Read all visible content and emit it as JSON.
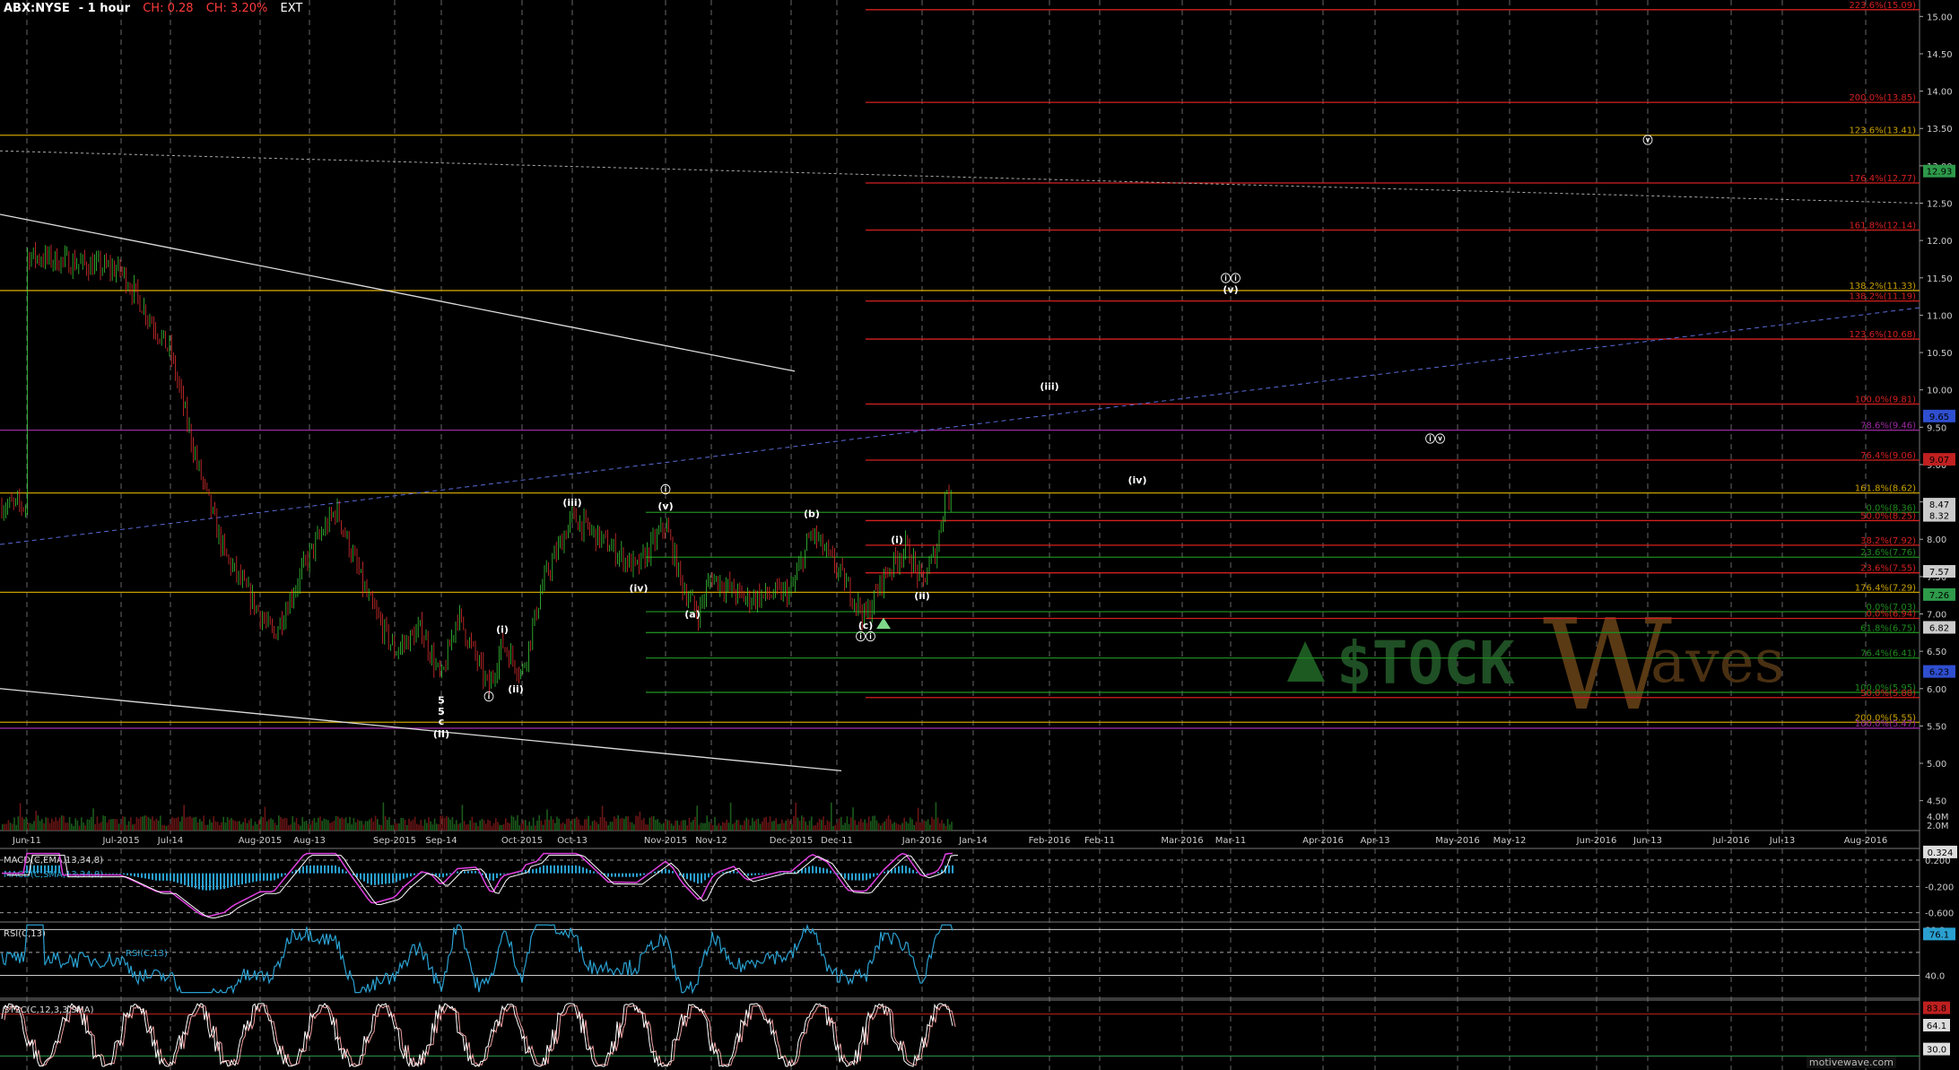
{
  "header": {
    "symbol": "ABX:NYSE",
    "interval": "- 1 hour",
    "change": "CH: 0.28",
    "change_pct": "CH: 3.20%",
    "session": "EXT"
  },
  "colors": {
    "background": "#000000",
    "candle_up": "#39c839",
    "candle_down": "#e03030",
    "fib_red": "#d42020",
    "fib_yellow": "#c8a000",
    "fib_green": "#1f8a1f",
    "purple": "#9a2aa0",
    "blue_dash": "#5a6ad8"
  },
  "watermark": "motivewave.com",
  "logo": {
    "left": "$TOCK",
    "right": "aves",
    "big": "W"
  },
  "chart_data": {
    "type": "candlestick",
    "title": "ABX:NYSE - 1 hour",
    "ylim": [
      4.1,
      15.1
    ],
    "price_axis": [
      "15.00",
      "14.50",
      "14.00",
      "13.50",
      "13.00",
      "12.50",
      "12.00",
      "11.50",
      "11.00",
      "10.50",
      "10.00",
      "9.50",
      "9.00",
      "8.50",
      "8.00",
      "7.50",
      "7.00",
      "6.50",
      "6.00",
      "5.50",
      "5.00",
      "4.50"
    ],
    "price_values": [
      15.0,
      14.5,
      14.0,
      13.5,
      13.0,
      12.5,
      12.0,
      11.5,
      11.0,
      10.5,
      10.0,
      9.5,
      9.0,
      8.5,
      8.0,
      7.5,
      7.0,
      6.5,
      6.0,
      5.5,
      5.0,
      4.5
    ],
    "time_axis": [
      "Jun-11",
      "Jul-2015",
      "Jul-14",
      "Aug-2015",
      "Aug-13",
      "Sep-2015",
      "Sep-14",
      "Oct-2015",
      "Oct-13",
      "Nov-2015",
      "Nov-12",
      "Dec-2015",
      "Dec-11",
      "Jan-2016",
      "Jan-14",
      "Feb-2016",
      "Feb-11",
      "Mar-2016",
      "Mar-11",
      "Apr-2016",
      "Apr-13",
      "May-2016",
      "May-12",
      "Jun-2016",
      "Jun-13",
      "Jul-2016",
      "Jul-13",
      "Aug-2016"
    ],
    "price_path": [
      [
        "Jun-11",
        11.8
      ],
      [
        "Jul-2015",
        11.6
      ],
      [
        "Jul-14",
        10.5
      ],
      [
        "Jul-20",
        9.0
      ],
      [
        "Jul-26",
        7.8
      ],
      [
        "Aug-2015",
        7.0
      ],
      [
        "Aug-04",
        6.7
      ],
      [
        "Aug-13",
        7.8
      ],
      [
        "Aug-19",
        8.4
      ],
      [
        "Aug-26",
        7.2
      ],
      [
        "Sep-2015",
        6.5
      ],
      [
        "Sep-06",
        6.8
      ],
      [
        "Sep-14",
        6.1
      ],
      [
        "Sep-18",
        7.0
      ],
      [
        "Sep-22",
        6.0
      ],
      [
        "Sep-26",
        6.6
      ],
      [
        "Oct-2015",
        6.2
      ],
      [
        "Oct-05",
        7.4
      ],
      [
        "Oct-13",
        8.3
      ],
      [
        "Oct-20",
        8.0
      ],
      [
        "Oct-26",
        7.6
      ],
      [
        "Nov-2015",
        8.2
      ],
      [
        "Nov-04",
        7.4
      ],
      [
        "Nov-08",
        7.0
      ],
      [
        "Nov-12",
        7.5
      ],
      [
        "Nov-20",
        7.2
      ],
      [
        "Dec-2015",
        7.3
      ],
      [
        "Dec-05",
        8.1
      ],
      [
        "Dec-11",
        7.6
      ],
      [
        "Dec-16",
        6.95
      ],
      [
        "Dec-20",
        7.5
      ],
      [
        "Dec-26",
        7.9
      ],
      [
        "Jan-2016",
        7.4
      ],
      [
        "Jan-05",
        7.9
      ],
      [
        "Jan-08",
        8.7
      ],
      [
        "Jan-09",
        8.45
      ]
    ],
    "last_price": "8.47",
    "volume_axis": [
      "4.0M",
      "2.0M"
    ],
    "fib_levels": [
      {
        "label": "223.6%(15.09)",
        "value": 15.09,
        "color": "red"
      },
      {
        "label": "200.0%(13.85)",
        "value": 13.85,
        "color": "red"
      },
      {
        "label": "123.6%(13.41)",
        "value": 13.41,
        "color": "yellow"
      },
      {
        "label": "176.4%(12.77)",
        "value": 12.77,
        "color": "red"
      },
      {
        "label": "161.8%(12.14)",
        "value": 12.14,
        "color": "red"
      },
      {
        "label": "138.2%(11.33)",
        "value": 11.33,
        "color": "yellow"
      },
      {
        "label": "138.2%(11.19)",
        "value": 11.19,
        "color": "red"
      },
      {
        "label": "123.6%(10.68)",
        "value": 10.68,
        "color": "red"
      },
      {
        "label": "100.0%(9.81)",
        "value": 9.81,
        "color": "red"
      },
      {
        "label": "78.6%(9.46)",
        "value": 9.46,
        "color": "purple"
      },
      {
        "label": "76.4%(9.06)",
        "value": 9.06,
        "color": "red"
      },
      {
        "label": "161.8%(8.62)",
        "value": 8.62,
        "color": "yellow"
      },
      {
        "label": "0.0%(8.36)",
        "value": 8.36,
        "color": "green"
      },
      {
        "label": "50.0%(8.25)",
        "value": 8.25,
        "color": "red"
      },
      {
        "label": "38.2%(7.92)",
        "value": 7.92,
        "color": "red"
      },
      {
        "label": "23.6%(7.76)",
        "value": 7.76,
        "color": "green"
      },
      {
        "label": "23.6%(7.55)",
        "value": 7.55,
        "color": "red"
      },
      {
        "label": "176.4%(7.29)",
        "value": 7.29,
        "color": "yellow"
      },
      {
        "label": "0.0%(7.03)",
        "value": 7.03,
        "color": "green"
      },
      {
        "label": "0.0%(6.94)",
        "value": 6.94,
        "color": "red"
      },
      {
        "label": "61.8%(6.75)",
        "value": 6.75,
        "color": "green"
      },
      {
        "label": "76.4%(6.41)",
        "value": 6.41,
        "color": "green"
      },
      {
        "label": "100.0%(5.95)",
        "value": 5.95,
        "color": "green"
      },
      {
        "label": "50.0%(5.88)",
        "value": 5.88,
        "color": "red"
      },
      {
        "label": "200.0%(5.55)",
        "value": 5.55,
        "color": "yellow"
      },
      {
        "label": "100.0%(5.47)",
        "value": 5.47,
        "color": "purple"
      }
    ],
    "price_badges": [
      {
        "text": "12.93",
        "value": 12.93,
        "color": "#2e9a4a"
      },
      {
        "text": "9.65",
        "value": 9.65,
        "color": "#2f4fd0"
      },
      {
        "text": "9.07",
        "value": 9.07,
        "color": "#c02020"
      },
      {
        "text": "8.47",
        "value": 8.47,
        "color": "#cccccc"
      },
      {
        "text": "8.32",
        "value": 8.32,
        "color": "#cccccc"
      },
      {
        "text": "7.57",
        "value": 7.57,
        "color": "#cccccc"
      },
      {
        "text": "7.26",
        "value": 7.26,
        "color": "#2e9a4a"
      },
      {
        "text": "6.82",
        "value": 6.82,
        "color": "#cccccc"
      },
      {
        "text": "6.23",
        "value": 6.23,
        "color": "#2f4fd0"
      }
    ],
    "wave_labels": [
      {
        "text": "(iii)",
        "date": "Oct-13",
        "value": 8.45
      },
      {
        "text": "(iv)",
        "date": "Oct-28",
        "value": 7.3
      },
      {
        "text": "(v)",
        "date": "Nov-2015",
        "value": 8.4
      },
      {
        "text": "ⓘ",
        "date": "Nov-2015",
        "value": 8.62
      },
      {
        "text": "(a)",
        "date": "Nov-06",
        "value": 6.95
      },
      {
        "text": "(b)",
        "date": "Dec-05",
        "value": 8.3
      },
      {
        "text": "(c)",
        "date": "Dec-16",
        "value": 6.8
      },
      {
        "text": "ⓘⓘ",
        "date": "Dec-16",
        "value": 6.65
      },
      {
        "text": "(i)",
        "date": "Dec-30",
        "value": 7.95
      },
      {
        "text": "(ii)",
        "date": "Jan-2016",
        "value": 7.2
      },
      {
        "text": "(i)",
        "date": "Sep-26",
        "value": 6.75
      },
      {
        "text": "(ii)",
        "date": "Sep-29",
        "value": 5.95
      },
      {
        "text": "ⓘ",
        "date": "Sep-22",
        "value": 5.85
      },
      {
        "text": "5",
        "date": "Sep-14",
        "value": 5.8
      },
      {
        "text": "5",
        "date": "Sep-14",
        "value": 5.65
      },
      {
        "text": "c",
        "date": "Sep-14",
        "value": 5.52
      },
      {
        "text": "(II)",
        "date": "Sep-14",
        "value": 5.35
      },
      {
        "text": "(iii)",
        "date": "Feb-2016",
        "value": 10.0
      },
      {
        "text": "(iv)",
        "date": "Feb-20",
        "value": 8.75
      },
      {
        "text": "ⓘⓘ",
        "date": "Mar-11",
        "value": 11.45
      },
      {
        "text": "(v)",
        "date": "Mar-11",
        "value": 11.3
      },
      {
        "text": "ⓘⓥ",
        "date": "Apr-25",
        "value": 9.3
      },
      {
        "text": "ⓥ",
        "date": "Jun-13",
        "value": 13.3
      }
    ],
    "macd": {
      "label": "MACD(C,EMA,13,34,8)",
      "sublabel": "MACD(C,SMA,13,34,8)",
      "axis": [
        "0.200",
        "-0.200",
        "-0.600"
      ],
      "axis_values": [
        0.2,
        -0.2,
        -0.6
      ],
      "badge": "0.324",
      "badge_value": 0.324,
      "ylim": [
        -0.7,
        0.35
      ]
    },
    "rsi": {
      "label": "RSI(C,13)",
      "axis": [
        "80.0",
        "40.0"
      ],
      "axis_values": [
        80,
        40
      ],
      "badge": "76.1",
      "badge_value": 76.1,
      "ylim": [
        20,
        85
      ]
    },
    "stoch": {
      "label": "STSC(C,12,3,3,SMA)",
      "badges": [
        "83.8",
        "64.1",
        "30.0"
      ],
      "badge_values": [
        83.8,
        64.1,
        30.0
      ],
      "ylim": [
        0,
        100
      ]
    }
  }
}
